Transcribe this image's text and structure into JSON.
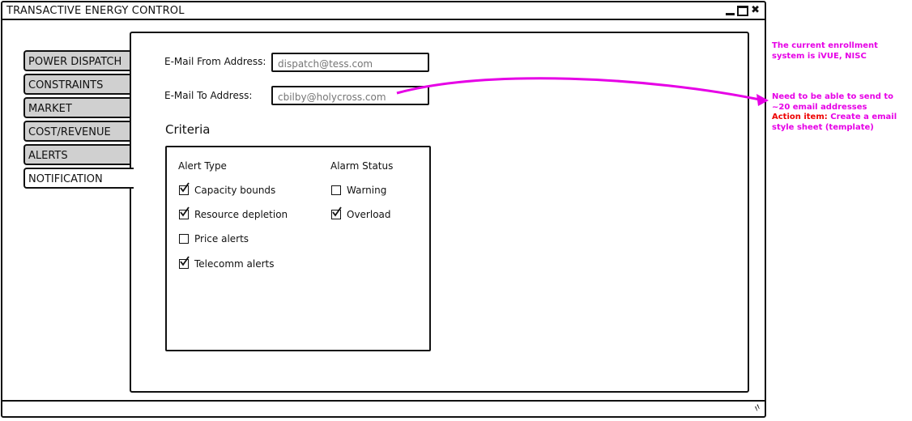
{
  "window": {
    "title": "TRANSACTIVE ENERGY CONTROL",
    "close_glyph": "✖"
  },
  "tabs": [
    {
      "label": "POWER DISPATCH",
      "active": false
    },
    {
      "label": "CONSTRAINTS",
      "active": false
    },
    {
      "label": "MARKET",
      "active": false
    },
    {
      "label": "COST/REVENUE",
      "active": false
    },
    {
      "label": "ALERTS",
      "active": false
    },
    {
      "label": "NOTIFICATION",
      "active": true
    }
  ],
  "form": {
    "email_from_label": "E-Mail From Address:",
    "email_from_placeholder": "dispatch@tess.com",
    "email_to_label": "E-Mail To Address:",
    "email_to_placeholder": "cbilby@holycross.com"
  },
  "criteria": {
    "title": "Criteria",
    "alert_type_header": "Alert Type",
    "alarm_status_header": "Alarm Status",
    "alert_types": [
      {
        "label": "Capacity bounds",
        "checked": true
      },
      {
        "label": "Resource depletion",
        "checked": true
      },
      {
        "label": "Price alerts",
        "checked": false
      },
      {
        "label": "Telecomm alerts",
        "checked": true
      }
    ],
    "alarm_statuses": [
      {
        "label": "Warning",
        "checked": false
      },
      {
        "label": "Overload",
        "checked": true
      }
    ]
  },
  "annotations": {
    "enrollment_note": "The current enrollment system is iVUE, NISC",
    "email_note": "Need to be able to send to ~20 email addresses",
    "action_label": "Action item:",
    "action_text": "Create a email style sheet (template)"
  },
  "colors": {
    "annotation": "#e600e6",
    "action_item": "#ee0000",
    "inactive_tab": "#d0d0d0"
  }
}
